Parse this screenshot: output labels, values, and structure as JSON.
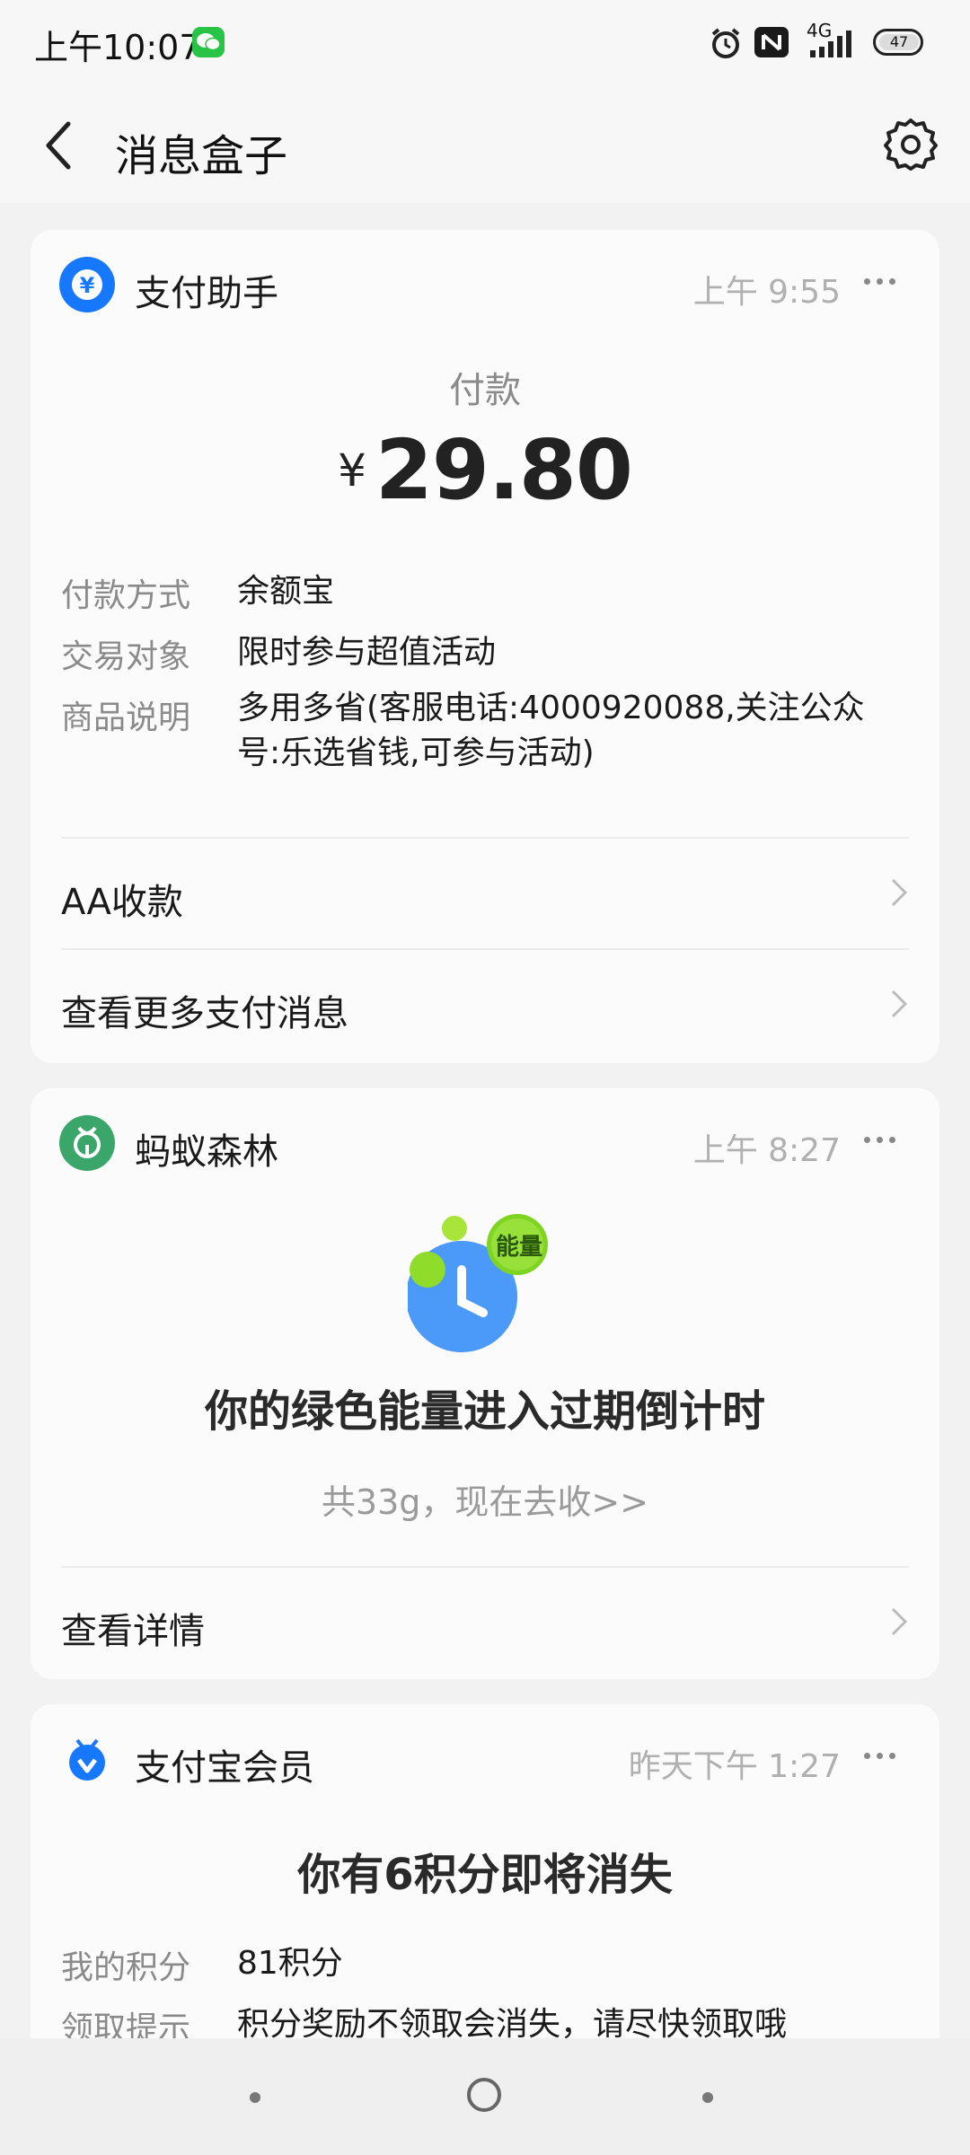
{
  "status": {
    "time": "上午10:07",
    "network": "4G",
    "battery": "47"
  },
  "header": {
    "title": "消息盒子"
  },
  "payment_card": {
    "app_name": "支付助手",
    "time": "上午 9:55",
    "label": "付款",
    "currency": "¥",
    "amount": "29.80",
    "details": [
      {
        "key": "付款方式",
        "value": "余额宝"
      },
      {
        "key": "交易对象",
        "value": "限时参与超值活动"
      },
      {
        "key": "商品说明",
        "value": "多用多省(客服电话:4000920088,关注公众号:乐选省钱,可参与活动)"
      }
    ],
    "actions": [
      {
        "label": "AA收款"
      },
      {
        "label": "查看更多支付消息"
      }
    ]
  },
  "forest_card": {
    "app_name": "蚂蚁森林",
    "time": "上午 8:27",
    "badge": "能量",
    "headline": "你的绿色能量进入过期倒计时",
    "subline": "共33g，现在去收>>",
    "action": "查看详情"
  },
  "member_card": {
    "app_name": "支付宝会员",
    "time": "昨天下午 1:27",
    "headline": "你有6积分即将消失",
    "details": [
      {
        "key": "我的积分",
        "value": "81积分"
      },
      {
        "key": "领取提示",
        "value": "积分奖励不领取会消失，请尽快领取哦"
      }
    ]
  },
  "colors": {
    "alipay_blue": "#1677ff",
    "forest_green": "#3aa66a",
    "energy_green": "#7fd321"
  }
}
